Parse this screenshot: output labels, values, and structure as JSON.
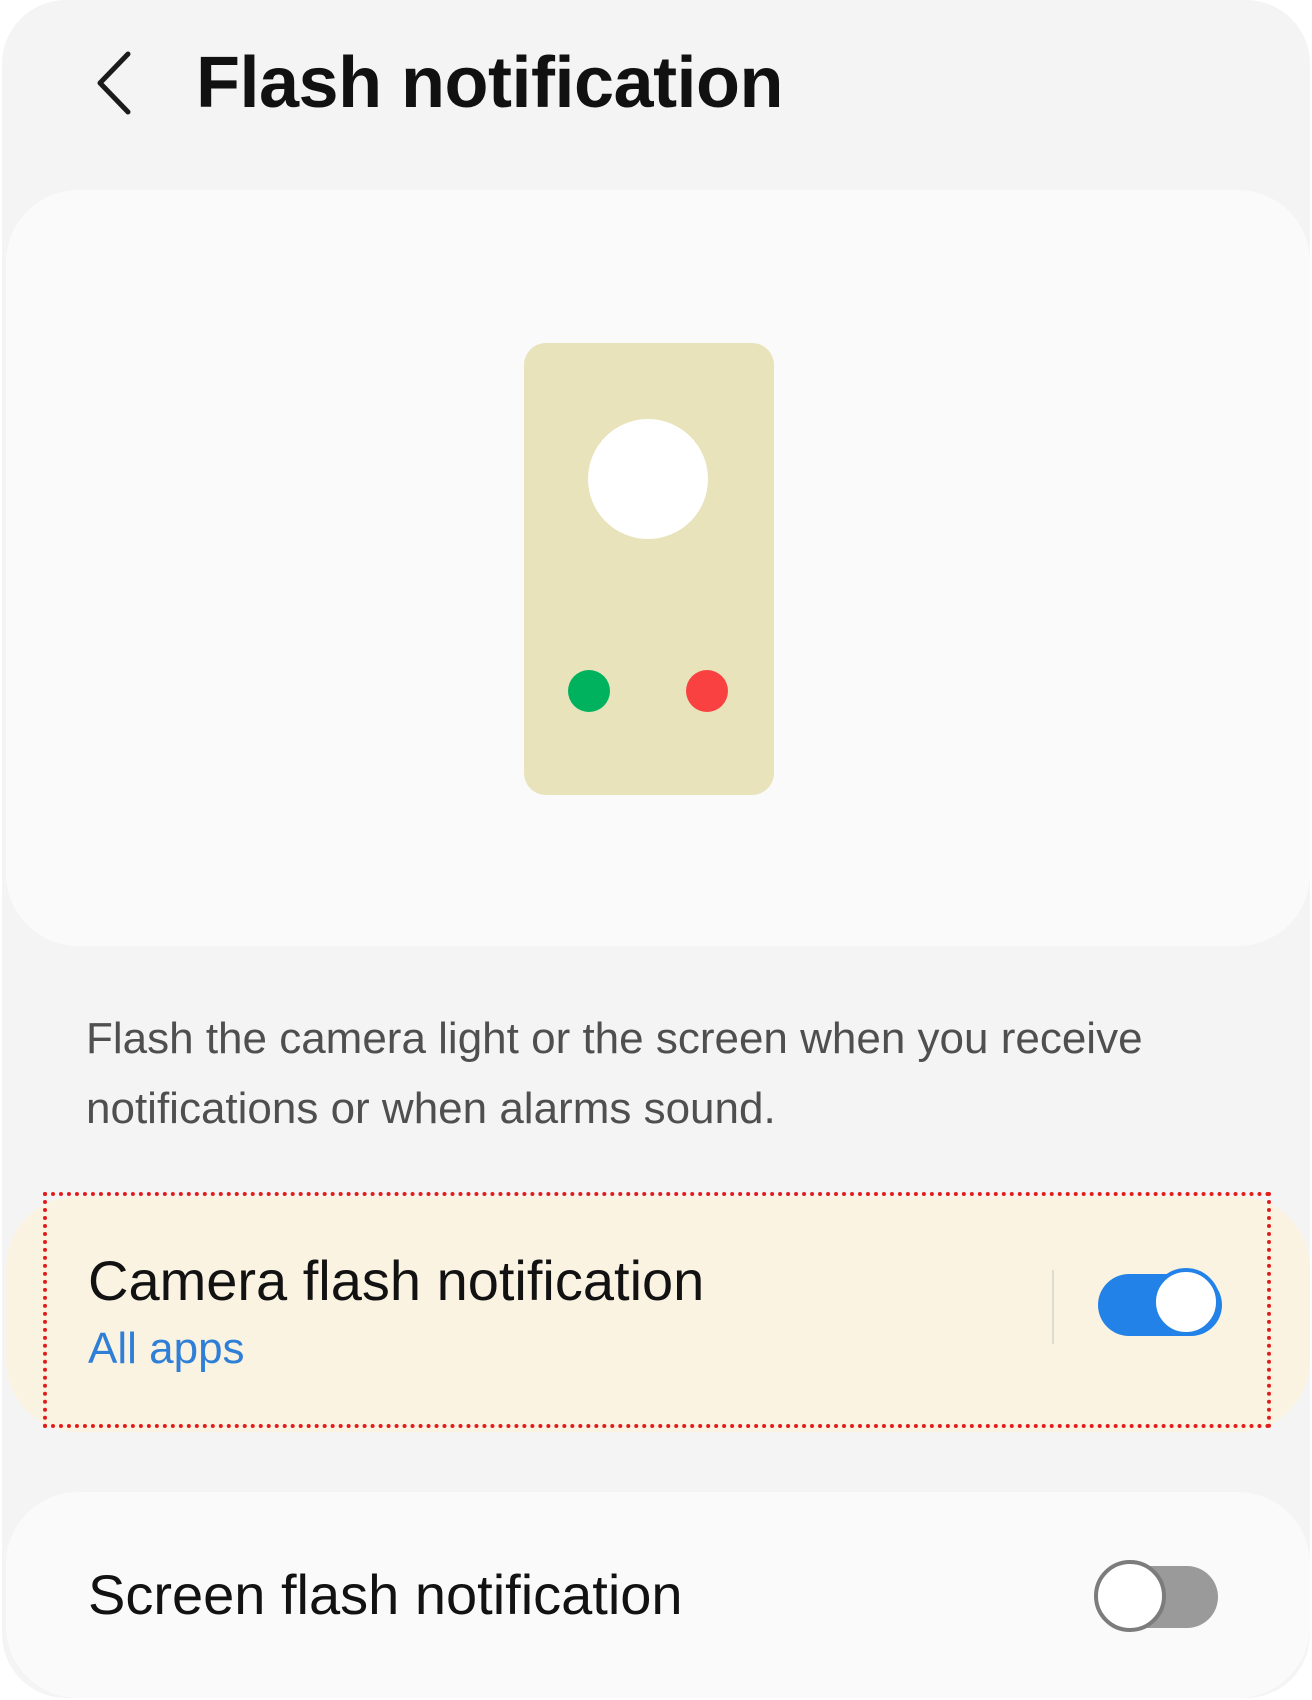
{
  "header": {
    "back_icon": "chevron-left-icon",
    "title": "Flash notification"
  },
  "illustration": {
    "description": "",
    "colors": {
      "device": "#e8e3bb",
      "flash": "#ffffff",
      "green_dot": "#00b25d",
      "red_dot": "#fa4141"
    }
  },
  "description": "Flash the camera light or the screen when you receive notifications or when alarms sound.",
  "settings": [
    {
      "title": "Camera flash notification",
      "subtitle": "All apps",
      "enabled": true
    },
    {
      "title": "Screen flash notification",
      "enabled": false
    }
  ],
  "colors": {
    "accent": "#2282e8",
    "highlight_border": "#e31c1c",
    "highlight_fill": "#fbf3e2"
  }
}
